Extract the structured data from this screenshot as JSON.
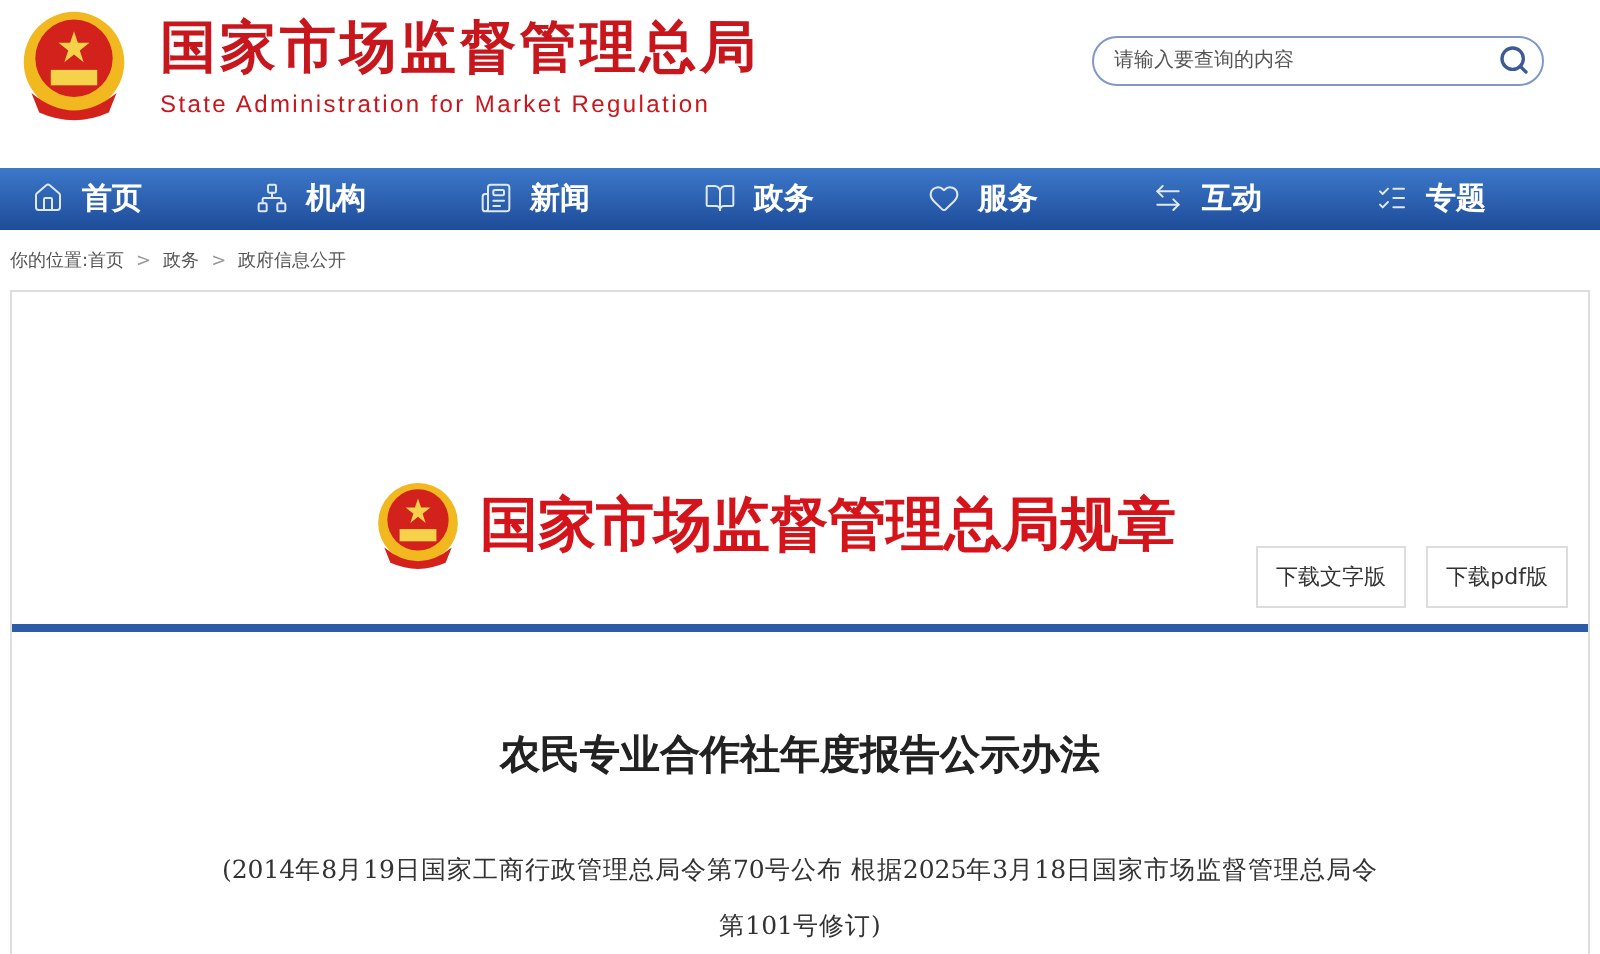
{
  "header": {
    "title": "国家市场监督管理总局",
    "subtitle": "State Administration for Market Regulation",
    "search": {
      "placeholder": "请输入要查询的内容"
    }
  },
  "nav": [
    {
      "label": "首页",
      "kind": "home"
    },
    {
      "label": "机构",
      "kind": "org"
    },
    {
      "label": "新闻",
      "kind": "news"
    },
    {
      "label": "政务",
      "kind": "book"
    },
    {
      "label": "服务",
      "kind": "heart"
    },
    {
      "label": "互动",
      "kind": "swap"
    },
    {
      "label": "专题",
      "kind": "list"
    }
  ],
  "breadcrumb": [
    {
      "kind": "link",
      "text": "你的位置:首页"
    },
    {
      "kind": "separator",
      "text": ">"
    },
    {
      "kind": "link",
      "text": "政务"
    },
    {
      "kind": "separator",
      "text": ">"
    },
    {
      "kind": "link",
      "text": "政府信息公开"
    }
  ],
  "banner": {
    "title": "国家市场监督管理总局规章",
    "buttons": [
      "下载文字版",
      "下载pdf版"
    ]
  },
  "document": {
    "title": "农民专业合作社年度报告公示办法",
    "note_lines": [
      "(2014年8月19日国家工商行政管理总局令第70号公布 根据2025年3月18日国家市场监督管理总局令",
      "第101号修订)"
    ]
  }
}
